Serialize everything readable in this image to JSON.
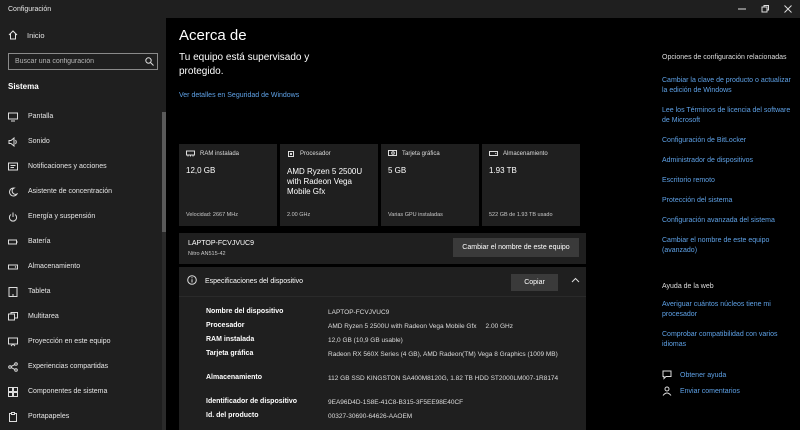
{
  "window": {
    "title": "Configuración",
    "controls": [
      "minimize",
      "maximize",
      "close"
    ]
  },
  "sidebar": {
    "home_label": "Inicio",
    "search_placeholder": "Buscar una configuración",
    "section_title": "Sistema",
    "items": [
      {
        "label": "Pantalla",
        "icon": "monitor-icon"
      },
      {
        "label": "Sonido",
        "icon": "speaker-icon"
      },
      {
        "label": "Notificaciones y acciones",
        "icon": "notification-icon"
      },
      {
        "label": "Asistente de concentración",
        "icon": "moon-icon"
      },
      {
        "label": "Energía y suspensión",
        "icon": "power-icon"
      },
      {
        "label": "Batería",
        "icon": "battery-icon"
      },
      {
        "label": "Almacenamiento",
        "icon": "storage-icon"
      },
      {
        "label": "Tableta",
        "icon": "tablet-icon"
      },
      {
        "label": "Multitarea",
        "icon": "multitask-icon"
      },
      {
        "label": "Proyección en este equipo",
        "icon": "projection-icon"
      },
      {
        "label": "Experiencias compartidas",
        "icon": "share-icon"
      },
      {
        "label": "Componentes de sistema",
        "icon": "components-icon"
      },
      {
        "label": "Portapapeles",
        "icon": "clipboard-icon"
      }
    ]
  },
  "main": {
    "title": "Acerca de",
    "supervised_text": "Tu equipo está supervisado y protegido.",
    "security_link": "Ver detalles en Seguridad de Windows",
    "cards": [
      {
        "label": "RAM instalada",
        "value": "12,0 GB",
        "sub": "Velocidad: 2667 MHz",
        "icon": "ram-icon"
      },
      {
        "label": "Procesador",
        "value": "AMD Ryzen 5 2500U with Radeon Vega Mobile Gfx",
        "sub": "2.00 GHz",
        "icon": "cpu-icon"
      },
      {
        "label": "Tarjeta gráfica",
        "value": "5 GB",
        "sub": "Varias GPU instaladas",
        "icon": "gpu-icon"
      },
      {
        "label": "Almacenamiento",
        "value": "1.93 TB",
        "sub": "522 GB de 1.93 TB usado",
        "icon": "disk-icon"
      }
    ],
    "device": {
      "name": "LAPTOP-FCVJVUC9",
      "model": "Nitro AN515-42",
      "rename_label": "Cambiar el nombre de este equipo"
    },
    "specs": {
      "title": "Especificaciones del dispositivo",
      "copy_label": "Copiar",
      "rows": [
        {
          "label": "Nombre del dispositivo",
          "value": "LAPTOP-FCVJVUC9"
        },
        {
          "label": "Procesador",
          "value": "AMD Ryzen 5 2500U with Radeon Vega Mobile Gfx     2.00 GHz"
        },
        {
          "label": "RAM instalada",
          "value": "12,0 GB (10,9 GB usable)"
        },
        {
          "label": "Tarjeta gráfica",
          "value": "Radeon RX 560X Series (4 GB), AMD Radeon(TM) Vega 8 Graphics (1009 MB)"
        },
        {
          "label": "Almacenamiento",
          "value": "112 GB SSD KINGSTON SA400M8120G, 1.82 TB HDD ST2000LM007-1R8174"
        },
        {
          "label": "Identificador de dispositivo",
          "value": "9EA96D4D-1S8E-41C8-B315-3F5EE98E40CF"
        },
        {
          "label": "Id. del producto",
          "value": "00327-30690-64626-AAOEM"
        }
      ]
    }
  },
  "right_panel": {
    "related_title": "Opciones de configuración relacionadas",
    "related_links": [
      "Cambiar la clave de producto o actualizar la edición de Windows",
      "Lee los Términos de licencia del software de Microsoft",
      "Configuración de BitLocker",
      "Administrador de dispositivos",
      "Escritorio remoto",
      "Protección del sistema",
      "Configuración avanzada del sistema",
      "Cambiar el nombre de este equipo (avanzado)"
    ],
    "help_title": "Ayuda de la web",
    "help_links": [
      "Averiguar cuántos núcleos tiene mi procesador",
      "Comprobar compatibilidad con varios idiomas"
    ],
    "get_help": "Obtener ayuda",
    "feedback": "Enviar comentarios"
  },
  "colors": {
    "accent_link": "#5ea1e6",
    "sidebar_bg": "#1f1f1f",
    "main_bg": "#000000",
    "card_bg": "#1f1f1f"
  }
}
